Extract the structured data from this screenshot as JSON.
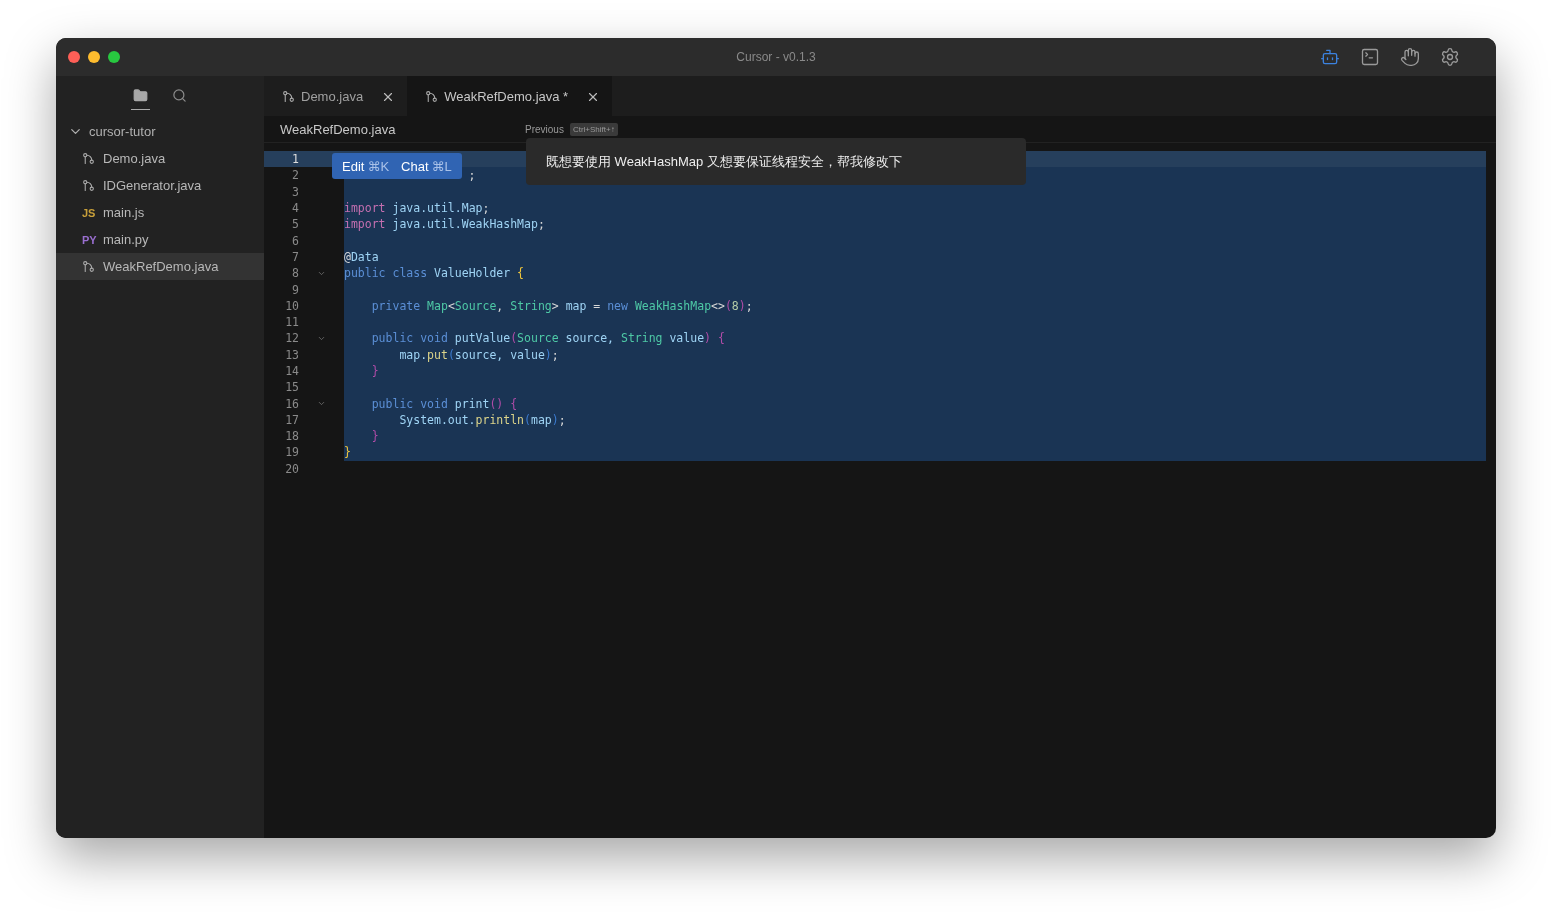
{
  "window": {
    "title": "Cursor - v0.1.3"
  },
  "titlebar_actions": [
    {
      "kind": "bot",
      "selected": true
    },
    {
      "kind": "terminal",
      "selected": false
    },
    {
      "kind": "hand",
      "selected": false
    },
    {
      "kind": "settings",
      "selected": false
    }
  ],
  "sidebar": {
    "views": [
      {
        "kind": "files",
        "selected": true
      },
      {
        "kind": "search",
        "selected": false
      }
    ],
    "folder": {
      "name": "cursor-tutor",
      "expanded": true,
      "children": [
        {
          "name": "Demo.java",
          "kind": "java",
          "selected": false
        },
        {
          "name": "IDGenerator.java",
          "kind": "java",
          "selected": false
        },
        {
          "name": "main.js",
          "kind": "js",
          "badge": "JS",
          "color": "#c9a03a",
          "selected": false
        },
        {
          "name": "main.py",
          "kind": "py",
          "badge": "PY",
          "color": "#9a6fd0",
          "selected": false
        },
        {
          "name": "WeakRefDemo.java",
          "kind": "java",
          "selected": true
        }
      ]
    }
  },
  "tabs": [
    {
      "label": "Demo.java",
      "selected": false
    },
    {
      "label": "WeakRefDemo.java *",
      "selected": true
    }
  ],
  "breadcrumb": "WeakRefDemo.java",
  "history": {
    "label": "Previous",
    "shortcut": "Ctrl+Shift+↑"
  },
  "prompt": "既想要使用 WeakHashMap 又想要保证线程安全，帮我修改下",
  "inline_actions": [
    {
      "label": "Edit",
      "shortcut": "⌘K"
    },
    {
      "label": "Chat",
      "shortcut": "⌘L"
    }
  ],
  "code_lines": [
    {
      "number": "1",
      "current": true,
      "selected": false,
      "foldable": false
    },
    {
      "number": "2",
      "current": false,
      "selected": true,
      "foldable": false,
      "tokens": [
        {
          "text": "                  ;",
          "kind": "punct"
        }
      ]
    },
    {
      "number": "3",
      "current": false,
      "selected": true,
      "foldable": false
    },
    {
      "number": "4",
      "current": false,
      "selected": true,
      "foldable": false,
      "tokens": [
        {
          "text": "import",
          "kind": "import"
        },
        {
          "text": " java.util.Map",
          "kind": "ident"
        },
        {
          "text": ";",
          "kind": "punct"
        }
      ]
    },
    {
      "number": "5",
      "current": false,
      "selected": true,
      "foldable": false,
      "tokens": [
        {
          "text": "import",
          "kind": "import"
        },
        {
          "text": " java.util.WeakHashMap",
          "kind": "ident"
        },
        {
          "text": ";",
          "kind": "punct"
        }
      ]
    },
    {
      "number": "6",
      "current": false,
      "selected": true,
      "foldable": false
    },
    {
      "number": "7",
      "current": false,
      "selected": true,
      "foldable": false,
      "tokens": [
        {
          "text": "@",
          "kind": "punct"
        },
        {
          "text": "Data",
          "kind": "ident"
        }
      ]
    },
    {
      "number": "8",
      "current": false,
      "selected": true,
      "foldable": true,
      "tokens": [
        {
          "text": "public class",
          "kind": "keyword"
        },
        {
          "text": " ValueHolder ",
          "kind": "ident"
        },
        {
          "text": "{",
          "kind": "brace"
        }
      ]
    },
    {
      "number": "9",
      "current": false,
      "selected": true,
      "foldable": false
    },
    {
      "number": "10",
      "current": false,
      "selected": true,
      "foldable": false,
      "tokens": [
        {
          "text": "    private",
          "kind": "keyword"
        },
        {
          "text": " Map",
          "kind": "type"
        },
        {
          "text": "<",
          "kind": "punct"
        },
        {
          "text": "Source",
          "kind": "type"
        },
        {
          "text": ", ",
          "kind": "punct"
        },
        {
          "text": "String",
          "kind": "type"
        },
        {
          "text": "> ",
          "kind": "punct"
        },
        {
          "text": "map",
          "kind": "ident"
        },
        {
          "text": " = ",
          "kind": "punct"
        },
        {
          "text": "new",
          "kind": "keyword"
        },
        {
          "text": " WeakHashMap",
          "kind": "type"
        },
        {
          "text": "<>",
          "kind": "punct"
        },
        {
          "text": "(",
          "kind": "paren"
        },
        {
          "text": "8",
          "kind": "number"
        },
        {
          "text": ")",
          "kind": "paren"
        },
        {
          "text": ";",
          "kind": "punct"
        }
      ]
    },
    {
      "number": "11",
      "current": false,
      "selected": true,
      "foldable": false
    },
    {
      "number": "12",
      "current": false,
      "selected": true,
      "foldable": true,
      "tokens": [
        {
          "text": "    public void",
          "kind": "keyword"
        },
        {
          "text": " putValue",
          "kind": "ident"
        },
        {
          "text": "(",
          "kind": "paren"
        },
        {
          "text": "Source",
          "kind": "type"
        },
        {
          "text": " source, ",
          "kind": "ident"
        },
        {
          "text": "String",
          "kind": "type"
        },
        {
          "text": " value",
          "kind": "ident"
        },
        {
          "text": ")",
          "kind": "paren"
        },
        {
          "text": " {",
          "kind": "paren"
        }
      ]
    },
    {
      "number": "13",
      "current": false,
      "selected": true,
      "foldable": false,
      "tokens": [
        {
          "text": "        map.",
          "kind": "ident"
        },
        {
          "text": "put",
          "kind": "function"
        },
        {
          "text": "(",
          "kind": "bracket"
        },
        {
          "text": "source, value",
          "kind": "ident"
        },
        {
          "text": ")",
          "kind": "bracket"
        },
        {
          "text": ";",
          "kind": "punct"
        }
      ]
    },
    {
      "number": "14",
      "current": false,
      "selected": true,
      "foldable": false,
      "tokens": [
        {
          "text": "    }",
          "kind": "paren"
        }
      ]
    },
    {
      "number": "15",
      "current": false,
      "selected": true,
      "foldable": false
    },
    {
      "number": "16",
      "current": false,
      "selected": true,
      "foldable": true,
      "tokens": [
        {
          "text": "    public void",
          "kind": "keyword"
        },
        {
          "text": " print",
          "kind": "ident"
        },
        {
          "text": "()",
          "kind": "paren"
        },
        {
          "text": " {",
          "kind": "paren"
        }
      ]
    },
    {
      "number": "17",
      "current": false,
      "selected": true,
      "foldable": false,
      "tokens": [
        {
          "text": "        System.out.",
          "kind": "ident"
        },
        {
          "text": "println",
          "kind": "function"
        },
        {
          "text": "(",
          "kind": "bracket"
        },
        {
          "text": "map",
          "kind": "ident"
        },
        {
          "text": ")",
          "kind": "bracket"
        },
        {
          "text": ";",
          "kind": "punct"
        }
      ]
    },
    {
      "number": "18",
      "current": false,
      "selected": true,
      "foldable": false,
      "tokens": [
        {
          "text": "    }",
          "kind": "paren"
        }
      ]
    },
    {
      "number": "19",
      "current": false,
      "selected": true,
      "foldable": false,
      "tokens": [
        {
          "text": "}",
          "kind": "brace"
        }
      ]
    },
    {
      "number": "20",
      "current": false,
      "selected": false,
      "foldable": false
    }
  ]
}
